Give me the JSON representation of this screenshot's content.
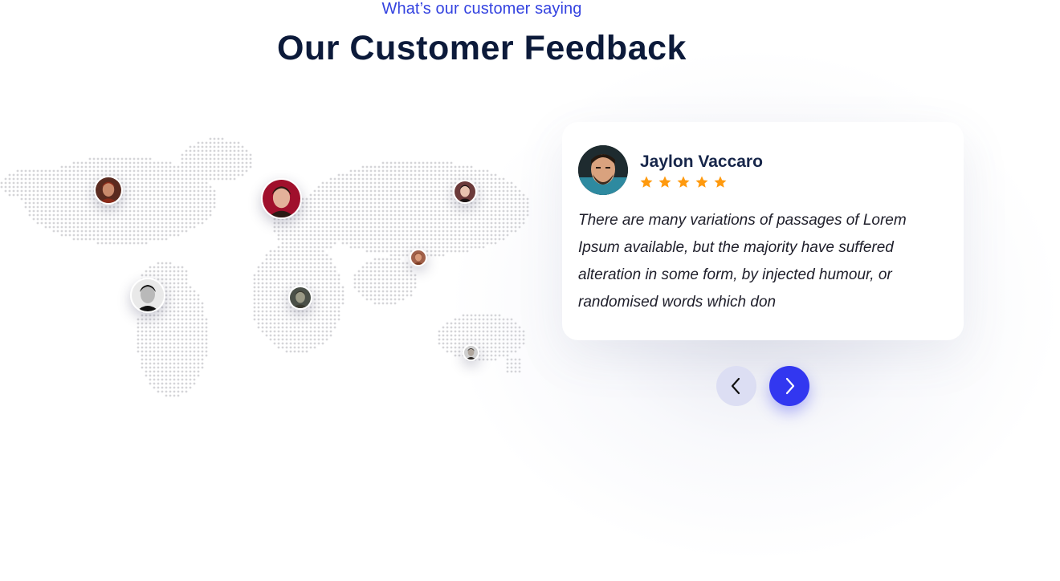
{
  "header": {
    "subtitle": "What’s our customer saying",
    "title": "Our Customer Feedback"
  },
  "map": {
    "icon": "world-dot-map",
    "dot_color": "#d5d5d8",
    "pins": [
      {
        "name": "pin-avatar-north-america-west",
        "skin": "#c98a6c",
        "hair": "#8a2b1a",
        "bg": "#5a2b20"
      },
      {
        "name": "pin-avatar-greenland",
        "skin": "#e3b19a",
        "hair": "#2a1a14",
        "bg": "#a0102c"
      },
      {
        "name": "pin-avatar-russia",
        "skin": "#e8c3b0",
        "hair": "#1a1212",
        "bg": "#6b3a3a"
      },
      {
        "name": "pin-avatar-south-america",
        "skin": "#b9b9b9",
        "hair": "#111111",
        "bg": "#e9e9e9"
      },
      {
        "name": "pin-avatar-africa",
        "skin": "#9a9a86",
        "hair": "#3a3a30",
        "bg": "#4a5048"
      },
      {
        "name": "pin-avatar-asia",
        "skin": "#d99a7a",
        "hair": "#7a3a20",
        "bg": "#a0604a"
      },
      {
        "name": "pin-avatar-australia",
        "skin": "#b0a69c",
        "hair": "#2a2622",
        "bg": "#cfcfcf"
      }
    ]
  },
  "testimonial": {
    "name": "Jaylon Vaccaro",
    "rating": 5,
    "star_color": "#ff9a0e",
    "quote": "There are many variations of passages of Lorem Ipsum available, but the majority have suffered alteration in some form, by injected humour, or randomised words which don"
  },
  "controls": {
    "prev_icon": "chevron-left-icon",
    "next_icon": "chevron-right-icon",
    "accent": "#3237f0"
  }
}
